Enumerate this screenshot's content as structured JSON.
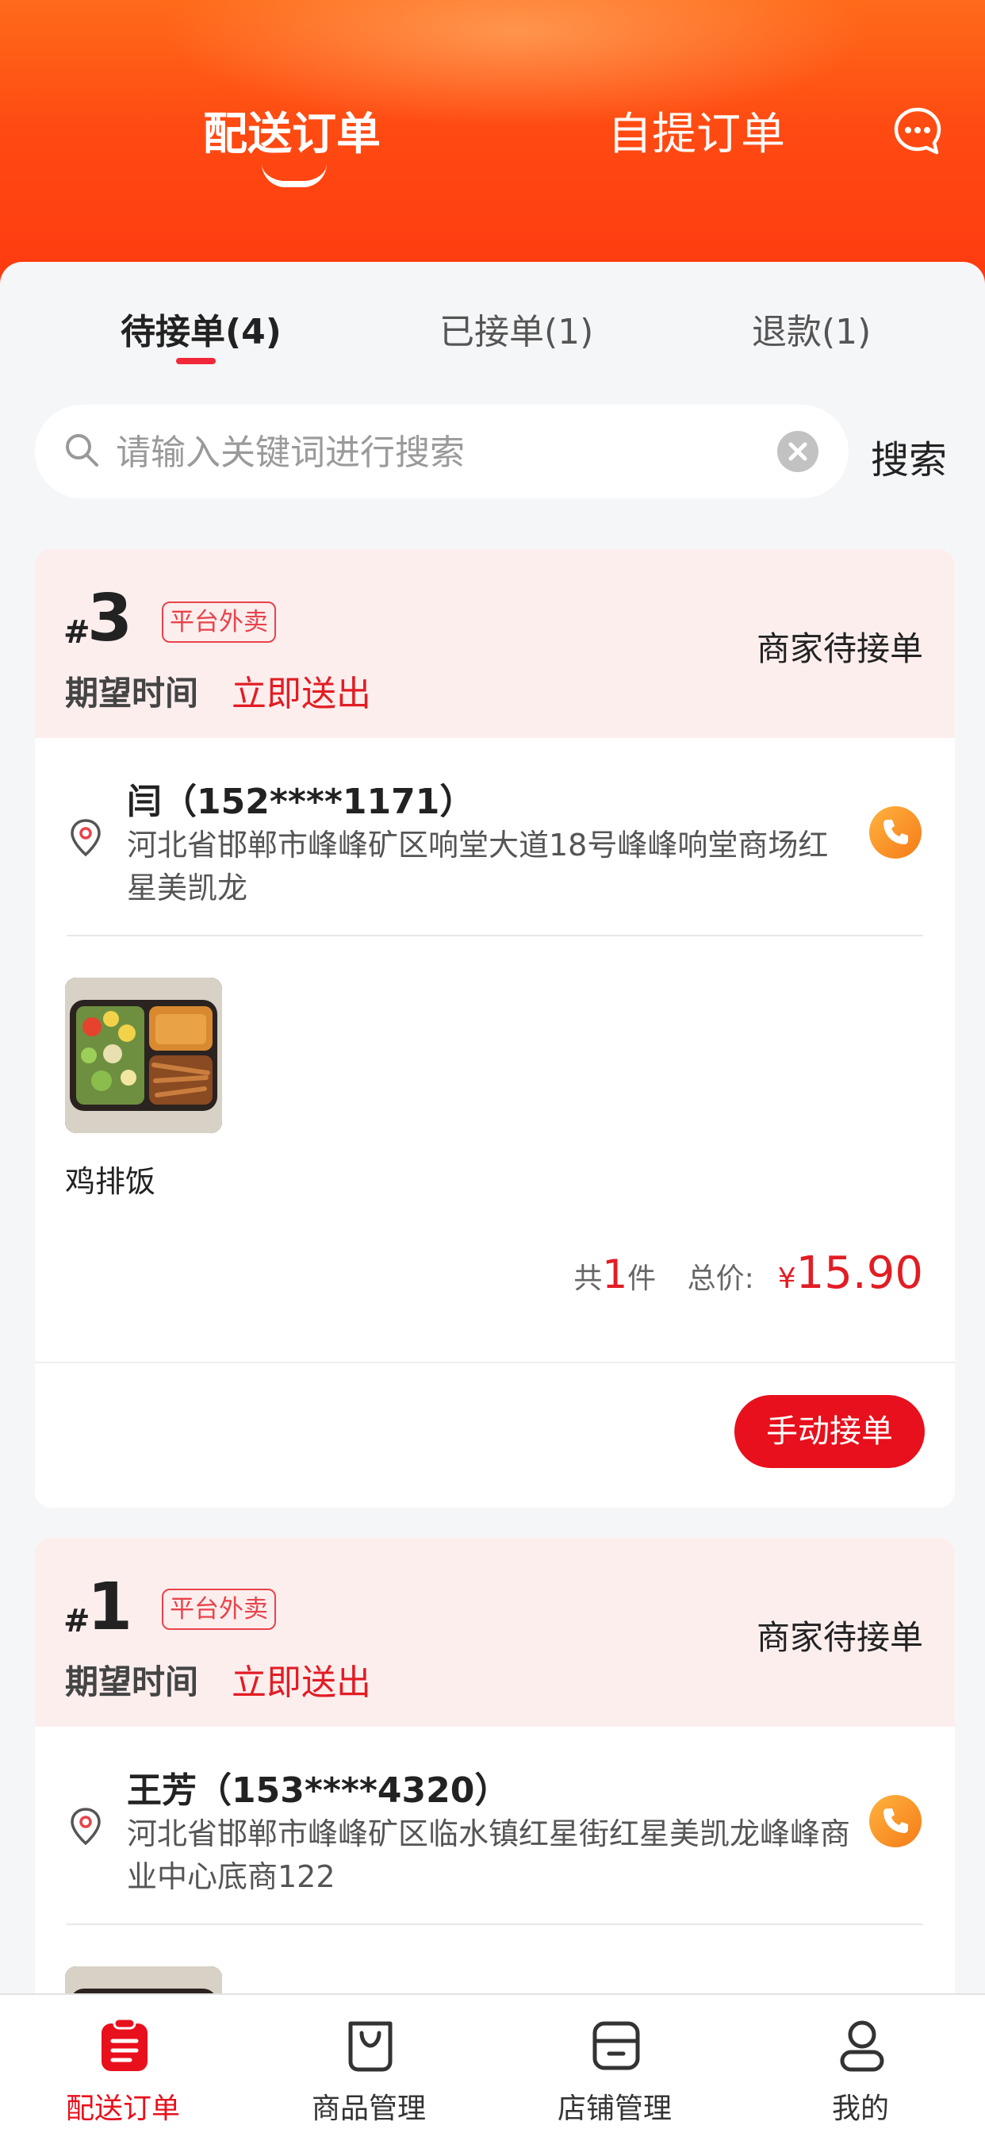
{
  "header": {
    "tab_delivery": "配送订单",
    "tab_pickup": "自提订单",
    "message_icon": "chat-bubble-icon"
  },
  "sub_tabs": [
    {
      "label": "待接单(4)",
      "active": true
    },
    {
      "label": "已接单(1)",
      "active": false
    },
    {
      "label": "退款(1)",
      "active": false
    }
  ],
  "search": {
    "placeholder": "请输入关键词进行搜索",
    "button": "搜索"
  },
  "orders": [
    {
      "hash": "#",
      "number": "3",
      "source_tag": "平台外卖",
      "status": "商家待接单",
      "expected_label": "期望时间",
      "expected_value": "立即送出",
      "customer": "闫（152****1171）",
      "address": "河北省邯郸市峰峰矿区响堂大道18号峰峰响堂商场红星美凯龙",
      "item_name": "鸡排饭",
      "count_prefix": "共",
      "count": "1",
      "count_suffix": "件",
      "total_label": "总价:",
      "currency": "¥",
      "total": "15.90",
      "accept_button": "手动接单"
    },
    {
      "hash": "#",
      "number": "1",
      "source_tag": "平台外卖",
      "status": "商家待接单",
      "expected_label": "期望时间",
      "expected_value": "立即送出",
      "customer": "王芳（153****4320）",
      "address": "河北省邯郸市峰峰矿区临水镇红星街红星美凯龙峰峰商业中心底商122"
    }
  ],
  "bottom_nav": [
    {
      "label": "配送订单",
      "icon": "clipboard-icon",
      "active": true
    },
    {
      "label": "商品管理",
      "icon": "shopping-bag-icon",
      "active": false
    },
    {
      "label": "店铺管理",
      "icon": "store-icon",
      "active": false
    },
    {
      "label": "我的",
      "icon": "user-icon",
      "active": false
    }
  ],
  "colors": {
    "brand_red": "#e8101c",
    "header_orange": "#ff4a12",
    "card_header_bg": "#fdeeee"
  }
}
